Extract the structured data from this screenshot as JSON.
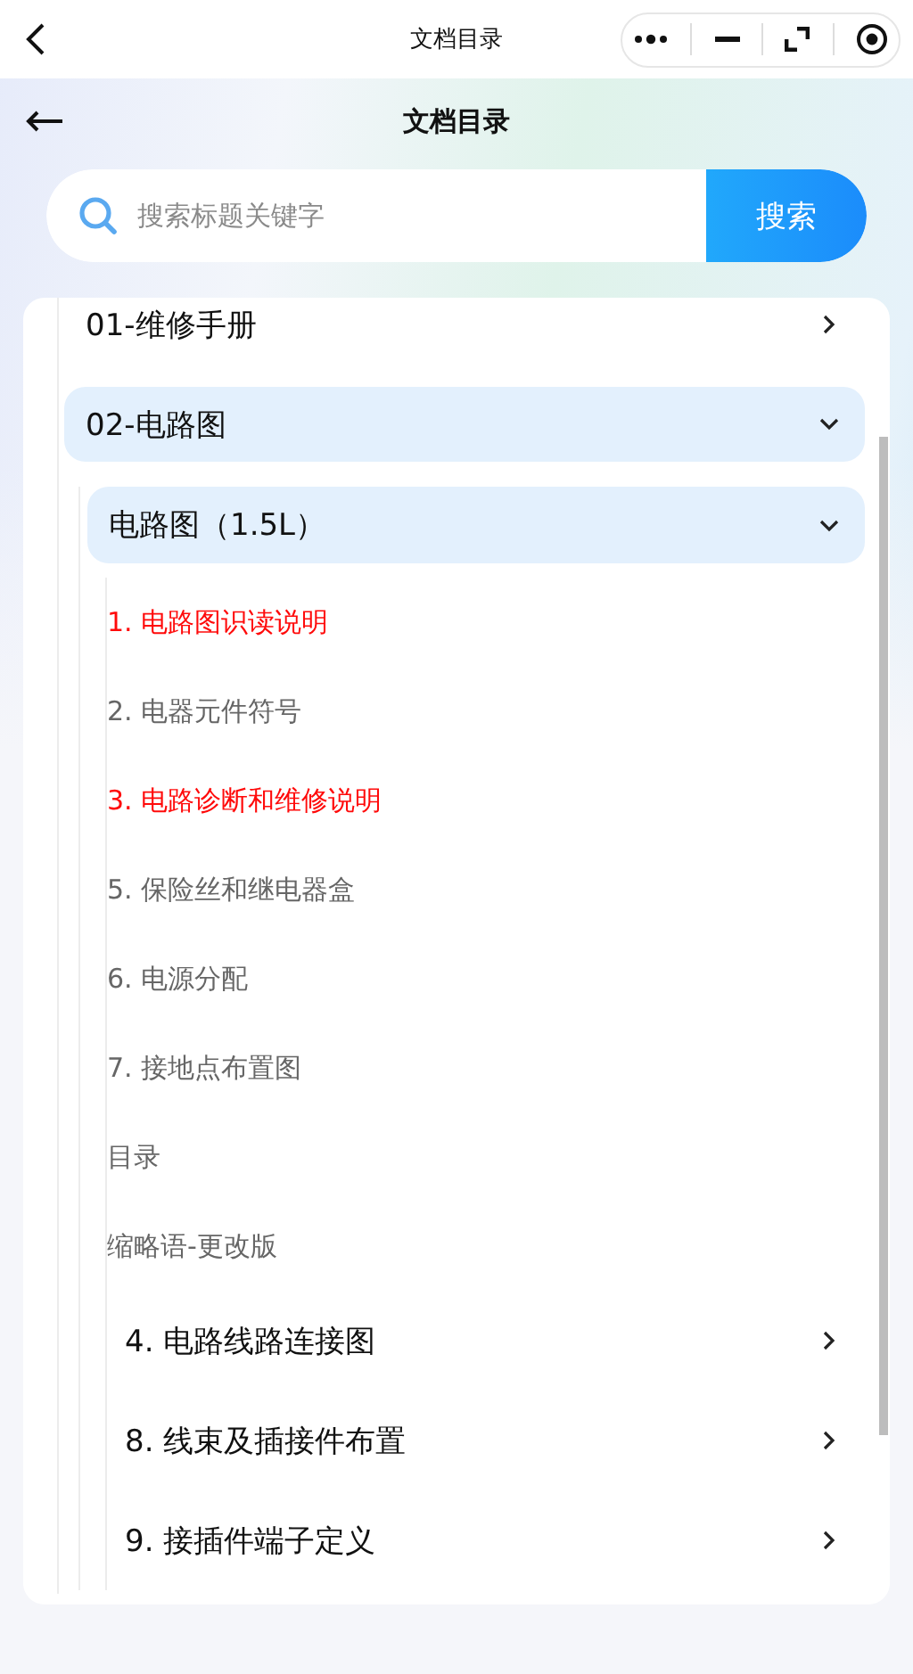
{
  "nav_bar": {
    "title": "文档目录"
  },
  "header": {
    "title": "文档目录"
  },
  "search": {
    "placeholder": "搜索标题关键字",
    "button": "搜索"
  },
  "tree": [
    {
      "kind": "folder",
      "label": "01-维修手册",
      "expanded": false
    },
    {
      "kind": "folder",
      "label": "02-电路图",
      "expanded": true,
      "children": [
        {
          "kind": "folder",
          "label": "电路图（1.5L）",
          "expanded": true,
          "children": [
            {
              "kind": "document",
              "label": "1. 电路图识读说明",
              "highlighted": true
            },
            {
              "kind": "document",
              "label": "2. 电器元件符号",
              "highlighted": false
            },
            {
              "kind": "document",
              "label": "3. 电路诊断和维修说明",
              "highlighted": true
            },
            {
              "kind": "document",
              "label": "5. 保险丝和继电器盒",
              "highlighted": false
            },
            {
              "kind": "document",
              "label": "6. 电源分配",
              "highlighted": false
            },
            {
              "kind": "document",
              "label": "7. 接地点布置图",
              "highlighted": false
            },
            {
              "kind": "document",
              "label": "目录",
              "highlighted": false
            },
            {
              "kind": "document",
              "label": "缩略语-更改版",
              "highlighted": false
            },
            {
              "kind": "folder",
              "label": "4. 电路线路连接图",
              "expanded": false
            },
            {
              "kind": "folder",
              "label": "8. 线束及插接件布置",
              "expanded": false
            },
            {
              "kind": "folder",
              "label": "9. 接插件端子定义",
              "expanded": false
            }
          ]
        }
      ]
    }
  ]
}
